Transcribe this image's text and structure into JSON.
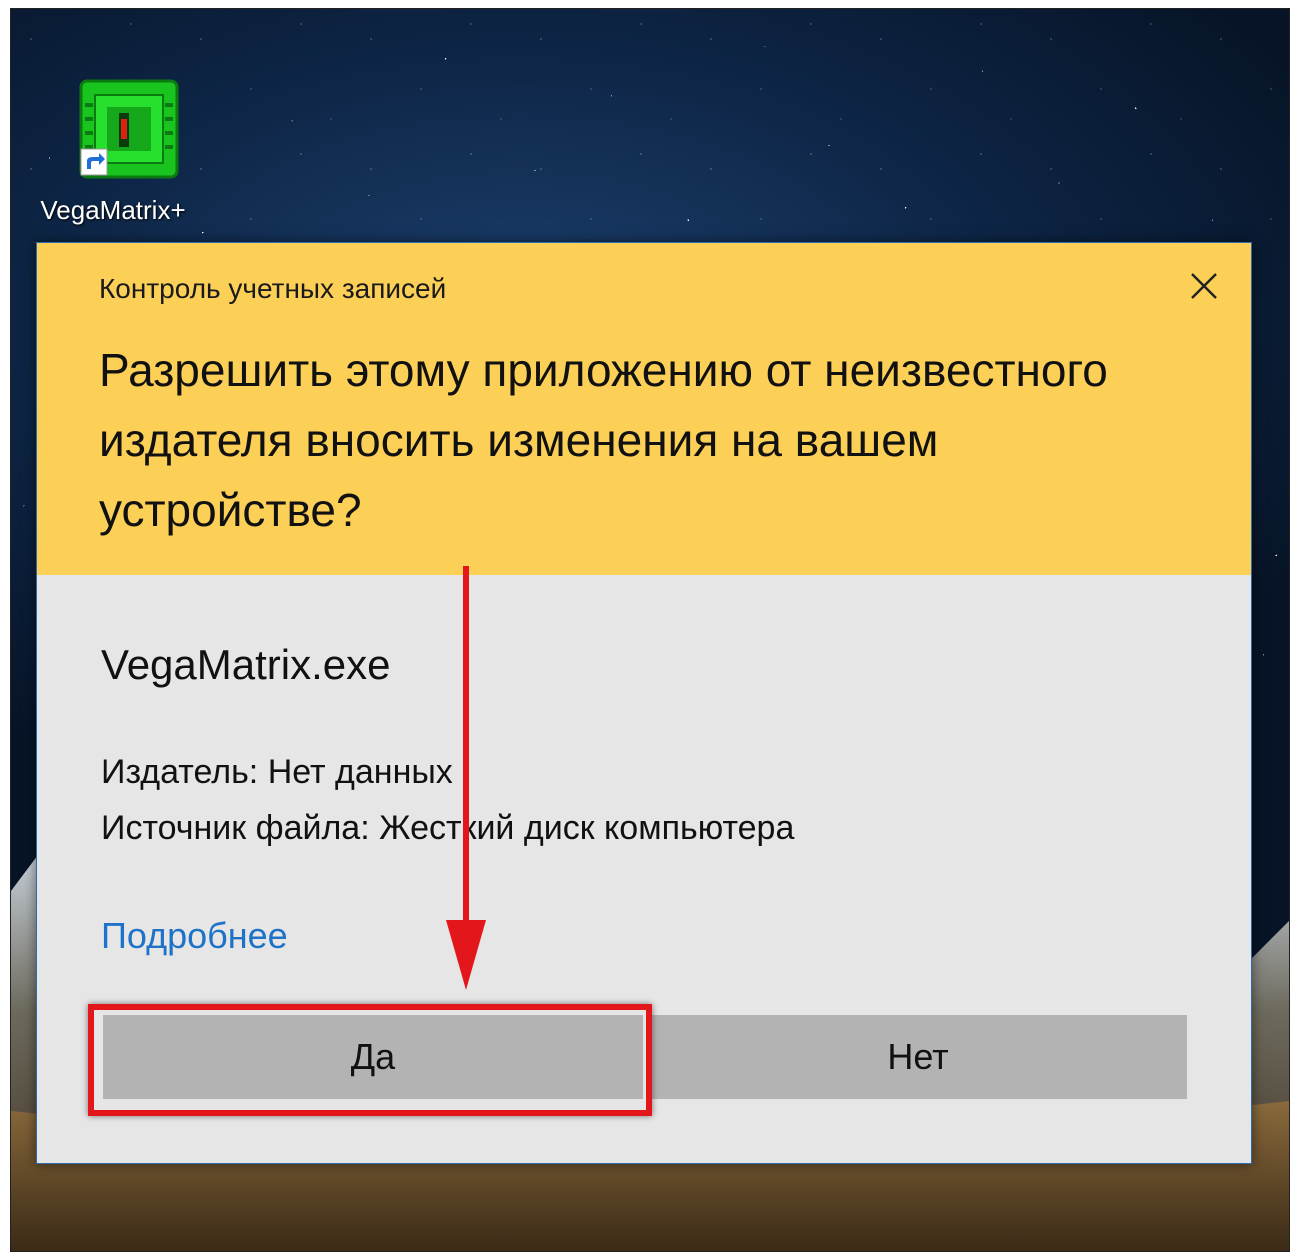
{
  "desktop": {
    "icon_label": "VegaMatrix+",
    "icon_name": "vegamatrix-shortcut-icon"
  },
  "dialog": {
    "title": "Контроль учетных записей",
    "question": "Разрешить этому приложению от неизвестного издателя вносить изменения на вашем устройстве?",
    "app_name": "VegaMatrix.exe",
    "publisher": "Издатель: Нет данных",
    "source": "Источник файла: Жесткий диск компьютера",
    "more_link": "Подробнее",
    "yes_button": "Да",
    "no_button": "Нет",
    "header_color": "#fccf57",
    "body_color": "#e6e6e6",
    "link_color": "#1e73c8"
  },
  "annotations": {
    "highlight_color": "#e3171b",
    "arrow_color": "#e3171b"
  }
}
